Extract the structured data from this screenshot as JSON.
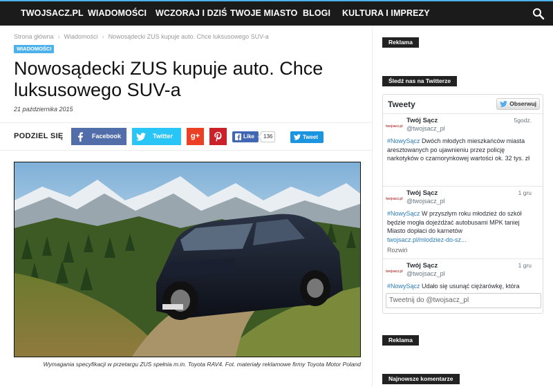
{
  "nav": {
    "items": [
      "TWOJSACZ.PL",
      "WIADOMOŚCI",
      "WCZORAJ I DZIŚ",
      "TWOJE MIASTO",
      "BLOGI",
      "KULTURA I IMPREZY"
    ],
    "search_icon": "search-icon"
  },
  "breadcrumb": {
    "home": "Strona główna",
    "section": "Wiadomości",
    "current": "Nowosądecki ZUS kupuje auto. Chce luksusowego SUV-a",
    "separator": "›"
  },
  "article": {
    "category": "WIADOMOŚCI",
    "title": "Nowosądecki ZUS kupuje auto. Chce luksusowego SUV-a",
    "date": "21 października 2015",
    "caption": "Wymagania specyfikacji w przetargu ZUS spełnia m.in. Toyota RAV4. Fot. materiały reklamowe firmy Toyota Motor Poland"
  },
  "share": {
    "label": "PODZIEL SIĘ",
    "facebook": "Facebook",
    "twitter": "Twitter",
    "gplus": "g+",
    "fb_like": "Like",
    "fb_like_count": "136",
    "tweet": "Tweet"
  },
  "sidebar": {
    "ad1": "Reklama",
    "twitter_block": "Śledź nas na Twitterze",
    "ad2": "Reklama",
    "comments_block": "Najnowsze komentarze"
  },
  "twitter_widget": {
    "header": "Tweety",
    "follow": "Obserwuj",
    "avatar_text": "twojsacz.pl",
    "input_placeholder": "Tweetnij do @twojsacz_pl",
    "tweets": [
      {
        "name": "Twój Sącz",
        "handle": "@twojsacz_pl",
        "time": "5godz.",
        "hashtag": "#NowySącz",
        "text": " Dwóch młodych mieszkańców miasta aresztowanych po ujawnieniu przez policję narkotyków o czarnorynkowej wartości ok. 32 tys. zł"
      },
      {
        "name": "Twój Sącz",
        "handle": "@twojsacz_pl",
        "time": "1 gru",
        "hashtag": "#NowySącz",
        "text": " W przyszłym roku młodzież do szkół będzie mogła dojeżdżać autobusami MPK taniej Miasto dopłaci do karnetów",
        "link": "twojsacz.pl/mlodziez-do-sz...",
        "expand": "Rozwiń"
      },
      {
        "name": "Twój Sącz",
        "handle": "@twojsacz_pl",
        "time": "1 gru",
        "hashtag": "#NowySącz",
        "text": " Udało się usunąć ciężarówkę, która"
      }
    ]
  },
  "colors": {
    "nav_bg": "#1b1b1b",
    "accent": "#4db2ec",
    "facebook": "#516eab",
    "twitter": "#29c5f6",
    "gplus": "#eb4026",
    "pinterest": "#ca212a",
    "tweet_link": "#2b7bb9"
  }
}
